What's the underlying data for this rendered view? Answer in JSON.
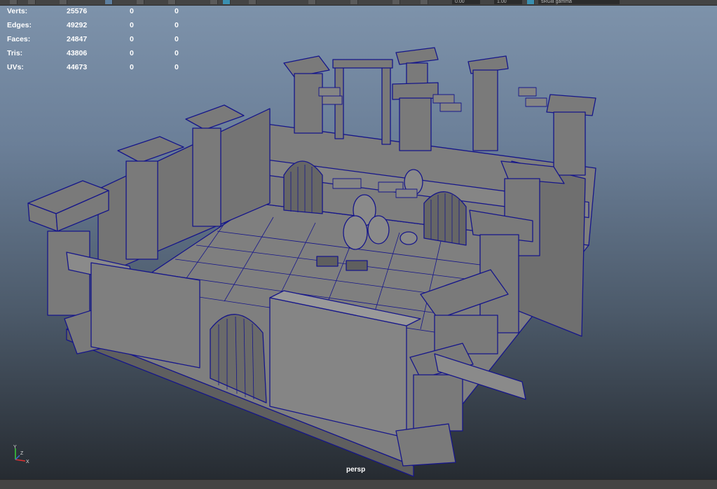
{
  "toolbar": {
    "exposure_value": "0.00",
    "gamma_value": "1.00",
    "color_space": "sRGB gamma"
  },
  "hud": {
    "rows": [
      {
        "label": "Verts:",
        "values": [
          "25576",
          "0",
          "0"
        ]
      },
      {
        "label": "Edges:",
        "values": [
          "49292",
          "0",
          "0"
        ]
      },
      {
        "label": "Faces:",
        "values": [
          "24847",
          "0",
          "0"
        ]
      },
      {
        "label": "Tris:",
        "values": [
          "43806",
          "0",
          "0"
        ]
      },
      {
        "label": "UVs:",
        "values": [
          "44673",
          "0",
          "0"
        ]
      }
    ]
  },
  "viewport": {
    "camera_label": "persp",
    "axis_labels": {
      "y": "Y",
      "x": "X",
      "z": "Z"
    },
    "colors": {
      "wireframe": "#16168a",
      "surface": "#7e7e7e",
      "surface_dark": "#5f5f5f"
    }
  }
}
